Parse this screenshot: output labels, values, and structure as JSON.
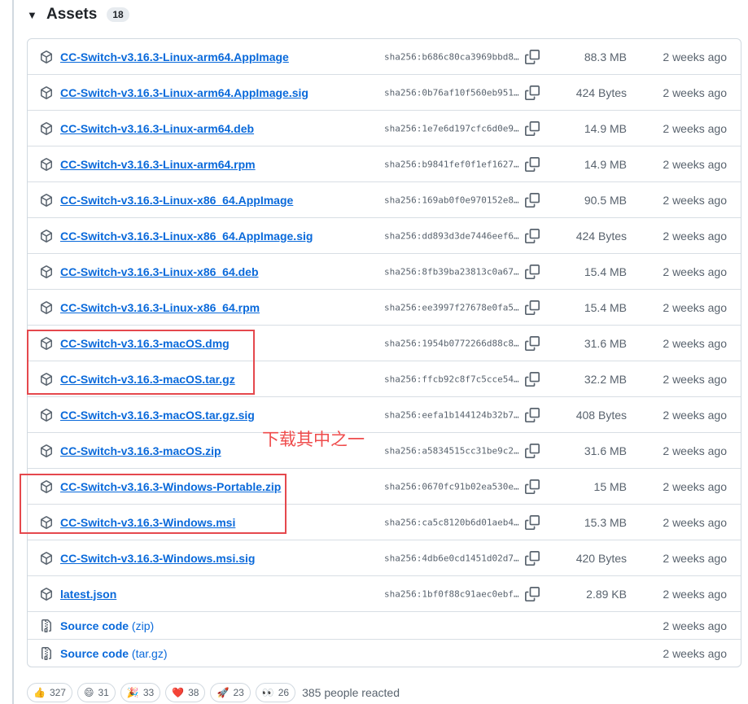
{
  "header": {
    "title": "Assets",
    "count": "18"
  },
  "assets": [
    {
      "name": "CC-Switch-v3.16.3-Linux-arm64.AppImage",
      "sha": "sha256:b686c80ca3969bbd8…",
      "size": "88.3 MB",
      "time": "2 weeks ago",
      "icon": "package-icon"
    },
    {
      "name": "CC-Switch-v3.16.3-Linux-arm64.AppImage.sig",
      "sha": "sha256:0b76af10f560eb951…",
      "size": "424 Bytes",
      "time": "2 weeks ago",
      "icon": "package-icon"
    },
    {
      "name": "CC-Switch-v3.16.3-Linux-arm64.deb",
      "sha": "sha256:1e7e6d197cfc6d0e9…",
      "size": "14.9 MB",
      "time": "2 weeks ago",
      "icon": "package-icon"
    },
    {
      "name": "CC-Switch-v3.16.3-Linux-arm64.rpm",
      "sha": "sha256:b9841fef0f1ef1627…",
      "size": "14.9 MB",
      "time": "2 weeks ago",
      "icon": "package-icon"
    },
    {
      "name": "CC-Switch-v3.16.3-Linux-x86_64.AppImage",
      "sha": "sha256:169ab0f0e970152e8…",
      "size": "90.5 MB",
      "time": "2 weeks ago",
      "icon": "package-icon"
    },
    {
      "name": "CC-Switch-v3.16.3-Linux-x86_64.AppImage.sig",
      "sha": "sha256:dd893d3de7446eef6…",
      "size": "424 Bytes",
      "time": "2 weeks ago",
      "icon": "package-icon"
    },
    {
      "name": "CC-Switch-v3.16.3-Linux-x86_64.deb",
      "sha": "sha256:8fb39ba23813c0a67…",
      "size": "15.4 MB",
      "time": "2 weeks ago",
      "icon": "package-icon"
    },
    {
      "name": "CC-Switch-v3.16.3-Linux-x86_64.rpm",
      "sha": "sha256:ee3997f27678e0fa5…",
      "size": "15.4 MB",
      "time": "2 weeks ago",
      "icon": "package-icon"
    },
    {
      "name": "CC-Switch-v3.16.3-macOS.dmg",
      "sha": "sha256:1954b0772266d88c8…",
      "size": "31.6 MB",
      "time": "2 weeks ago",
      "icon": "package-icon"
    },
    {
      "name": "CC-Switch-v3.16.3-macOS.tar.gz",
      "sha": "sha256:ffcb92c8f7c5cce54…",
      "size": "32.2 MB",
      "time": "2 weeks ago",
      "icon": "package-icon"
    },
    {
      "name": "CC-Switch-v3.16.3-macOS.tar.gz.sig",
      "sha": "sha256:eefa1b144124b32b7…",
      "size": "408 Bytes",
      "time": "2 weeks ago",
      "icon": "package-icon"
    },
    {
      "name": "CC-Switch-v3.16.3-macOS.zip",
      "sha": "sha256:a5834515cc31be9c2…",
      "size": "31.6 MB",
      "time": "2 weeks ago",
      "icon": "package-icon"
    },
    {
      "name": "CC-Switch-v3.16.3-Windows-Portable.zip",
      "sha": "sha256:0670fc91b02ea530e…",
      "size": "15 MB",
      "time": "2 weeks ago",
      "icon": "package-icon"
    },
    {
      "name": "CC-Switch-v3.16.3-Windows.msi",
      "sha": "sha256:ca5c8120b6d01aeb4…",
      "size": "15.3 MB",
      "time": "2 weeks ago",
      "icon": "package-icon"
    },
    {
      "name": "CC-Switch-v3.16.3-Windows.msi.sig",
      "sha": "sha256:4db6e0cd1451d02d7…",
      "size": "420 Bytes",
      "time": "2 weeks ago",
      "icon": "package-icon"
    },
    {
      "name": "latest.json",
      "sha": "sha256:1bf0f88c91aec0ebf…",
      "size": "2.89 KB",
      "time": "2 weeks ago",
      "icon": "package-icon"
    }
  ],
  "sources": [
    {
      "name": "Source code",
      "suffix": "(zip)",
      "time": "2 weeks ago",
      "icon": "file-zip-icon"
    },
    {
      "name": "Source code",
      "suffix": "(tar.gz)",
      "time": "2 weeks ago",
      "icon": "file-zip-icon"
    }
  ],
  "annotation": "下载其中之一",
  "reactions": [
    {
      "emoji": "👍",
      "count": "327",
      "icon": "thumbs-up-icon"
    },
    {
      "emoji": "😄",
      "count": "31",
      "icon": "laugh-icon"
    },
    {
      "emoji": "🎉",
      "count": "33",
      "icon": "hooray-icon"
    },
    {
      "emoji": "❤️",
      "count": "38",
      "icon": "heart-icon"
    },
    {
      "emoji": "🚀",
      "count": "23",
      "icon": "rocket-icon"
    },
    {
      "emoji": "👀",
      "count": "26",
      "icon": "eyes-icon"
    }
  ],
  "reacted_text": "385 people reacted",
  "colors": {
    "link": "#0969da",
    "muted": "#59636e",
    "border": "#d1d9e0",
    "highlight": "#e5484d",
    "annotation": "#ef4b4b"
  }
}
